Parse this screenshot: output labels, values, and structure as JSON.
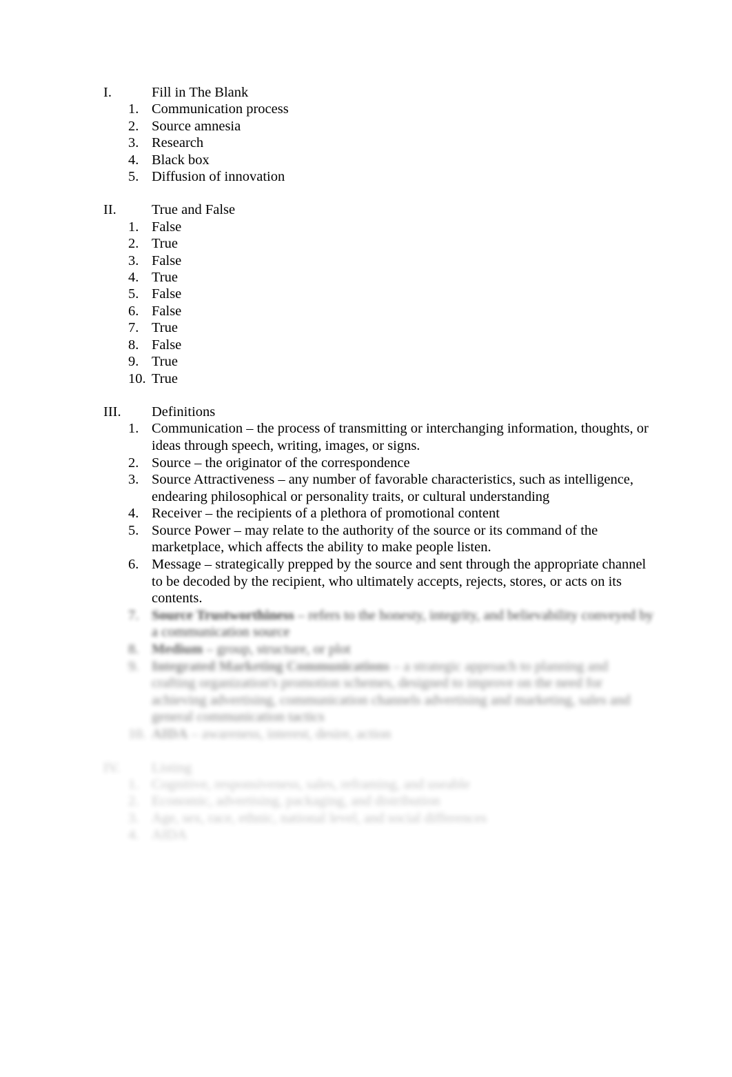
{
  "document": {
    "background_color": "#ffffff",
    "text_color": "#000000",
    "sections": [
      {
        "numeral": "I.",
        "title": "Fill in The Blank",
        "visibility": "clear",
        "items": [
          {
            "marker": "1.",
            "term": "",
            "text": "Communication process"
          },
          {
            "marker": "2.",
            "term": "",
            "text": "Source amnesia"
          },
          {
            "marker": "3.",
            "term": "",
            "text": "Research"
          },
          {
            "marker": "4.",
            "term": "",
            "text": "Black box"
          },
          {
            "marker": "5.",
            "term": "",
            "text": "Diffusion of innovation"
          }
        ]
      },
      {
        "numeral": "II.",
        "title": "True and False",
        "visibility": "clear",
        "items": [
          {
            "marker": "1.",
            "term": "",
            "text": "False"
          },
          {
            "marker": "2.",
            "term": "",
            "text": "True"
          },
          {
            "marker": "3.",
            "term": "",
            "text": "False"
          },
          {
            "marker": "4.",
            "term": "",
            "text": "True"
          },
          {
            "marker": "5.",
            "term": "",
            "text": "False"
          },
          {
            "marker": "6.",
            "term": "",
            "text": "False"
          },
          {
            "marker": "7.",
            "term": "",
            "text": "True"
          },
          {
            "marker": "8.",
            "term": "",
            "text": "False"
          },
          {
            "marker": "9.",
            "term": "",
            "text": "True"
          },
          {
            "marker": "10.",
            "term": "",
            "text": "True"
          }
        ]
      },
      {
        "numeral": "III.",
        "title": "Definitions",
        "visibility": "clear",
        "items": [
          {
            "marker": "1.",
            "term": "Communication ",
            "text": " – the process of transmitting or interchanging information, thoughts, or ideas through speech, writing, images, or signs."
          },
          {
            "marker": "2.",
            "term": "Source",
            "text": " – the originator of the correspondence"
          },
          {
            "marker": "3.",
            "term": "Source Attractiveness ",
            "text": " – any number of favorable characteristics, such as intelligence, endearing philosophical or personality traits, or cultural understanding"
          },
          {
            "marker": "4.",
            "term": "Receiver",
            "text": " – the recipients of a plethora of promotional content"
          },
          {
            "marker": "5.",
            "term": "Source Power ",
            "text": " – may relate to the authority of the source or its command of the marketplace, which affects the ability to make people listen."
          },
          {
            "marker": "6.",
            "term": "Message",
            "text": " – strategically prepped by the source and sent through the appropriate channel to be decoded by the recipient, who ultimately accepts, rejects, stores, or acts on its contents."
          }
        ],
        "obscured_items": [
          {
            "marker": "7.",
            "term": "Source Trustworthiness",
            "text": " – refers to the honesty, integrity, and believability conveyed by a communication source",
            "blur_level": 1
          },
          {
            "marker": "8.",
            "term": "Medium",
            "text": " – group, structure, or plot",
            "blur_level": 2
          },
          {
            "marker": "9.",
            "term": "Integrated Marketing Communications",
            "text": " – a strategic approach to planning and crafting organization's promotion schemes, designed to improve on the need for achieving advertising, communication channels advertising and marketing, sales and general communication tactics",
            "blur_level": 3
          },
          {
            "marker": "10.",
            "term": "AIDA",
            "text": " – awareness, interest, desire, action",
            "blur_level": 4
          }
        ]
      },
      {
        "numeral": "IV.",
        "title": "Listing",
        "visibility": "obscured",
        "blur_level": 5,
        "items": [
          {
            "marker": "1.",
            "term": "",
            "text": "Cognitive, responsiveness, sales, reframing, and useable"
          },
          {
            "marker": "2.",
            "term": "",
            "text": "Economic, advertising, packaging, and distribution"
          },
          {
            "marker": "3.",
            "term": "",
            "text": "Age, sex, race, ethnic, national level, and social differences"
          },
          {
            "marker": "4.",
            "term": "",
            "text": "AIDA"
          }
        ]
      }
    ]
  }
}
